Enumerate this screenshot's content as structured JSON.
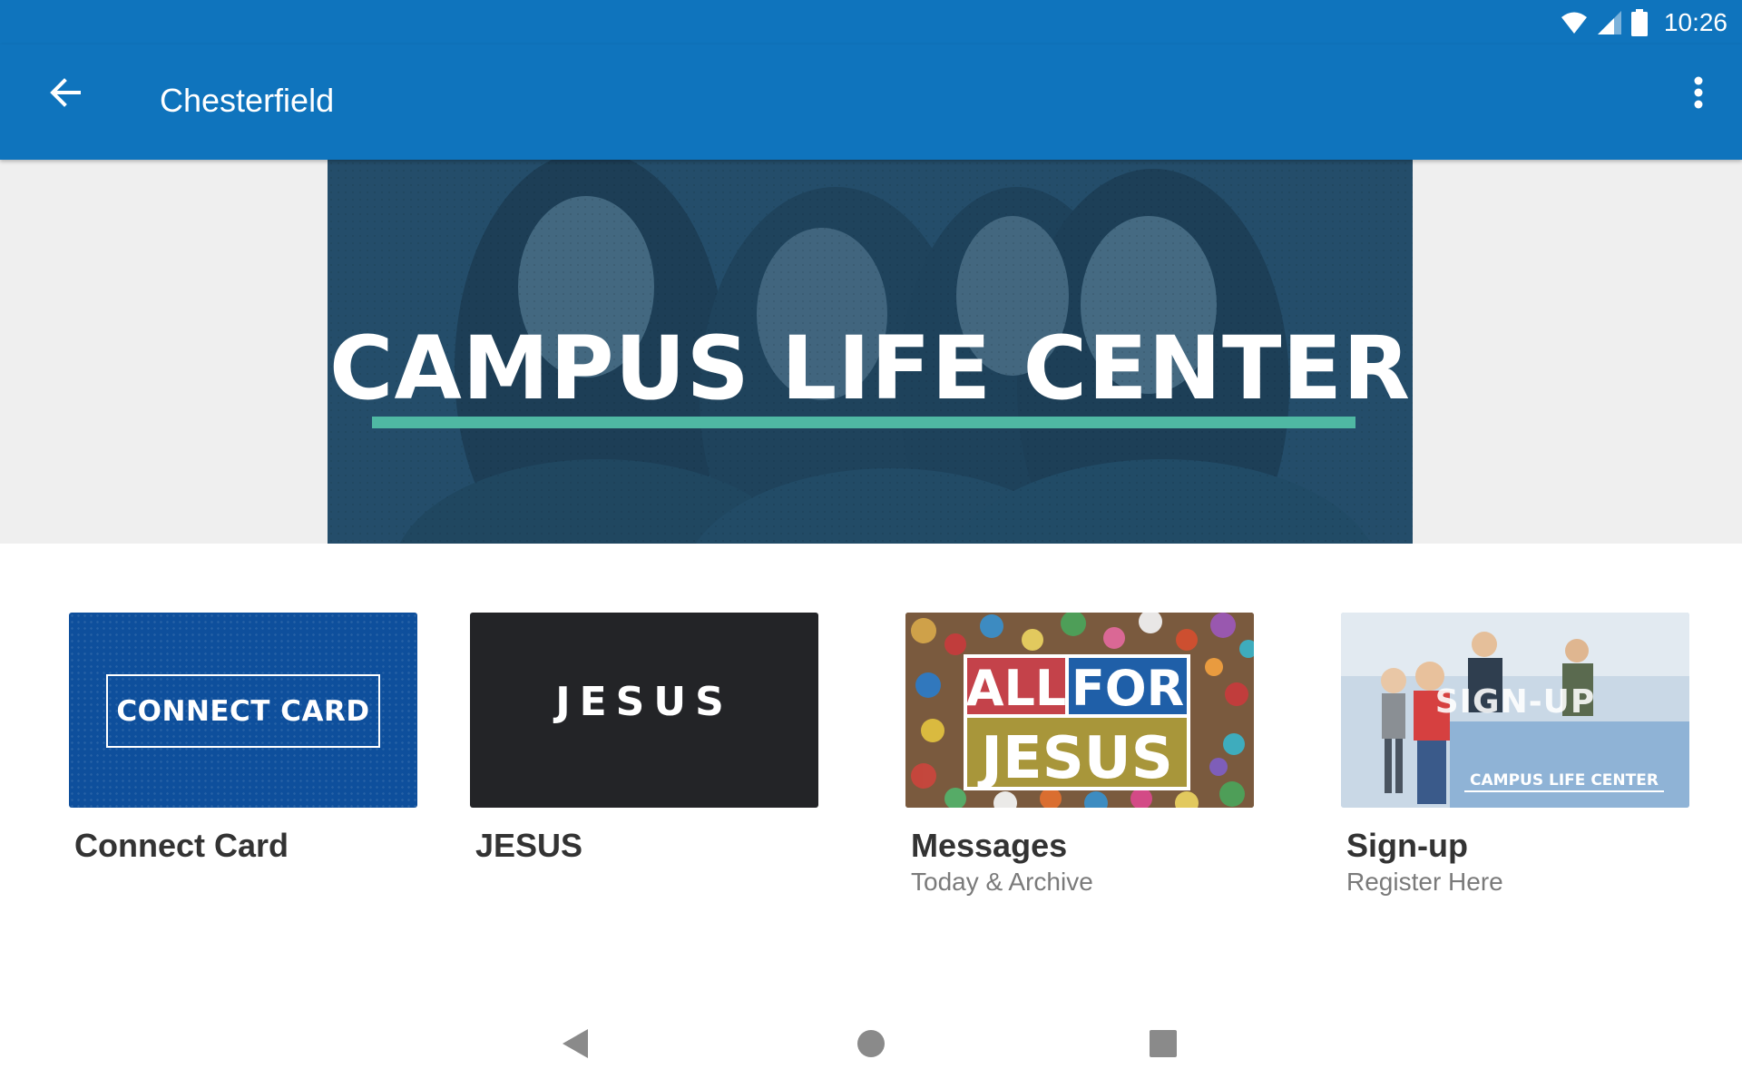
{
  "status_bar": {
    "time": "10:26",
    "icons": [
      "wifi-icon",
      "cell-signal-icon",
      "battery-icon"
    ]
  },
  "app_bar": {
    "title": "Chesterfield",
    "back_icon": "arrow-left-icon",
    "menu_icon": "more-vert-icon",
    "background": "#0f74bd"
  },
  "hero": {
    "title": "CAMPUS LIFE CENTER",
    "accent_color": "#4fb8a3"
  },
  "tiles": [
    {
      "title": "Connect Card",
      "subtitle": "",
      "thumb_text": "CONNECT CARD"
    },
    {
      "title": "JESUS",
      "subtitle": "",
      "thumb_text": "JESUS"
    },
    {
      "title": "Messages",
      "subtitle": "Today & Archive",
      "thumb_text_top": "ALL",
      "thumb_text_mid": "FOR",
      "thumb_text_bottom": "JESUS"
    },
    {
      "title": "Sign-up",
      "subtitle": "Register Here",
      "thumb_text": "SIGN-UP",
      "thumb_caption": "CAMPUS LIFE CENTER"
    }
  ],
  "nav_bar": {
    "icons": [
      "nav-back-icon",
      "nav-home-icon",
      "nav-recents-icon"
    ]
  }
}
